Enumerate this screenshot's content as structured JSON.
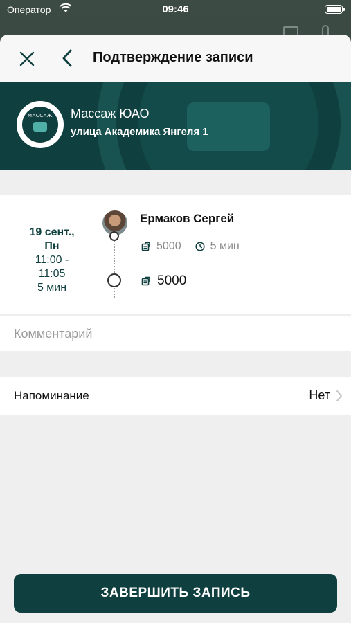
{
  "status_bar": {
    "carrier": "Оператор",
    "time": "09:46"
  },
  "nav": {
    "title": "Подтверждение записи",
    "close_icon": "close-icon",
    "back_icon": "chevron-left-icon"
  },
  "salon": {
    "logo_text": "МАССАЖ",
    "name": "Массаж ЮАО",
    "address": "улица Академика Янгеля 1"
  },
  "booking": {
    "date_line1": "19 сент.,",
    "date_line2": "Пн",
    "time_range_line1": "11:00 -",
    "time_range_line2": "11:05",
    "duration": "5 мин",
    "master": "Ермаков Сергей",
    "service_price": "5000",
    "service_duration": "5 мин",
    "total": "5000"
  },
  "comment": {
    "placeholder": "Комментарий",
    "value": ""
  },
  "reminder": {
    "label": "Напоминание",
    "value": "Нет"
  },
  "submit": {
    "label": "ЗАВЕРШИТЬ ЗАПИСЬ"
  },
  "colors": {
    "accent": "#0f3f3e",
    "background": "#efefef",
    "muted_text": "#8a8a8a"
  }
}
